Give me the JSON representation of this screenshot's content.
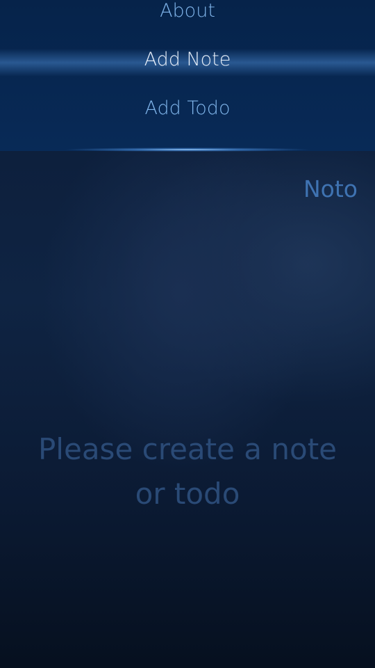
{
  "pulley_menu": {
    "items": [
      {
        "label": "About"
      },
      {
        "label": "Add Note"
      },
      {
        "label": "Add Todo"
      }
    ]
  },
  "page": {
    "title": "Noto",
    "placeholder": "Please create a note or todo"
  }
}
